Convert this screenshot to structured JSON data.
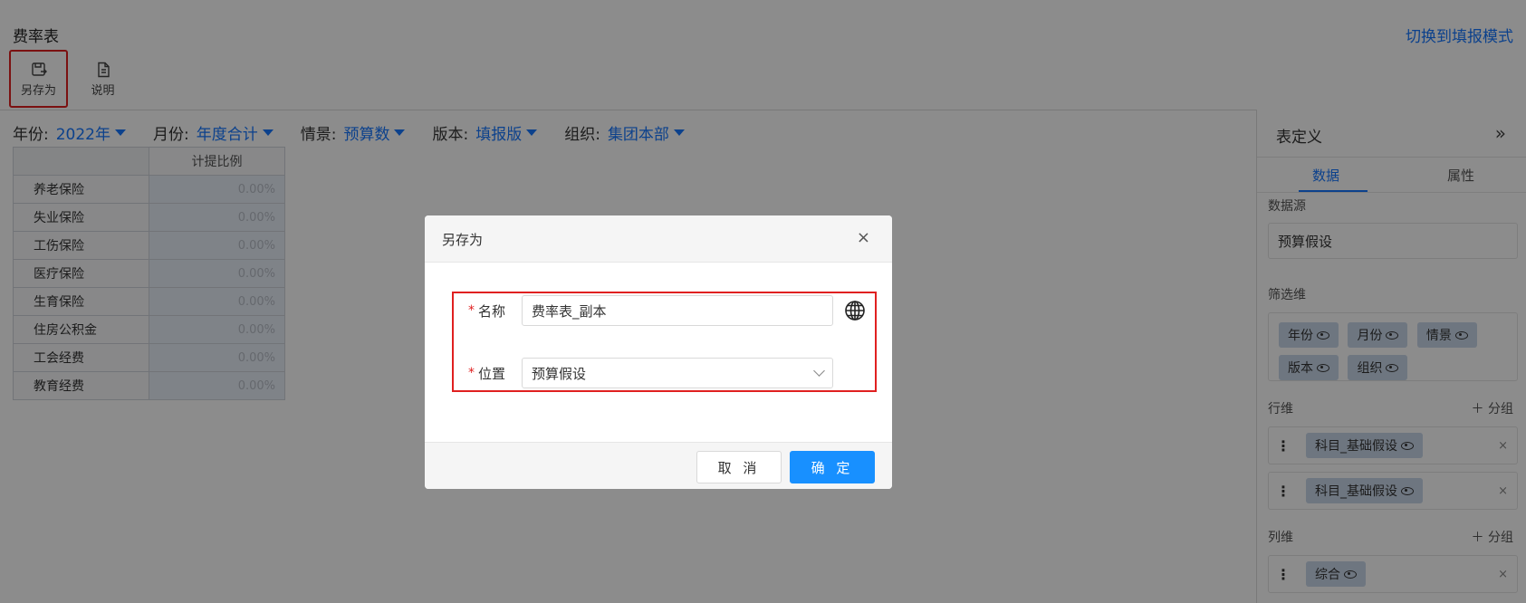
{
  "page": {
    "title": "费率表",
    "switch_link": "切换到填报模式"
  },
  "toolbar": {
    "save_as_label": "另存为",
    "desc_label": "说明"
  },
  "filters": [
    {
      "label": "年份:",
      "value": "2022年"
    },
    {
      "label": "月份:",
      "value": "年度合计"
    },
    {
      "label": "情景:",
      "value": "预算数"
    },
    {
      "label": "版本:",
      "value": "填报版"
    },
    {
      "label": "组织:",
      "value": "集团本部"
    }
  ],
  "grid": {
    "column_header": "计提比例",
    "rows": [
      {
        "label": "养老保险",
        "value": "0.00%"
      },
      {
        "label": "失业保险",
        "value": "0.00%"
      },
      {
        "label": "工伤保险",
        "value": "0.00%"
      },
      {
        "label": "医疗保险",
        "value": "0.00%"
      },
      {
        "label": "生育保险",
        "value": "0.00%"
      },
      {
        "label": "住房公积金",
        "value": "0.00%"
      },
      {
        "label": "工会经费",
        "value": "0.00%"
      },
      {
        "label": "教育经费",
        "value": "0.00%"
      }
    ]
  },
  "panel": {
    "title": "表定义",
    "tabs": {
      "data": "数据",
      "props": "属性"
    },
    "datasource_label": "数据源",
    "datasource_value": "预算假设",
    "filter_dims_label": "筛选维",
    "filter_dims": [
      "年份",
      "月份",
      "情景",
      "版本",
      "组织"
    ],
    "row_dims_label": "行维",
    "row_dims": [
      "科目_基础假设",
      "科目_基础假设"
    ],
    "col_dims_label": "列维",
    "col_dims": [
      "综合"
    ],
    "add_group": "分组"
  },
  "dialog": {
    "title": "另存为",
    "name_label": "名称",
    "name_value": "费率表_副本",
    "location_label": "位置",
    "location_value": "预算假设",
    "cancel": "取 消",
    "ok": "确 定"
  }
}
